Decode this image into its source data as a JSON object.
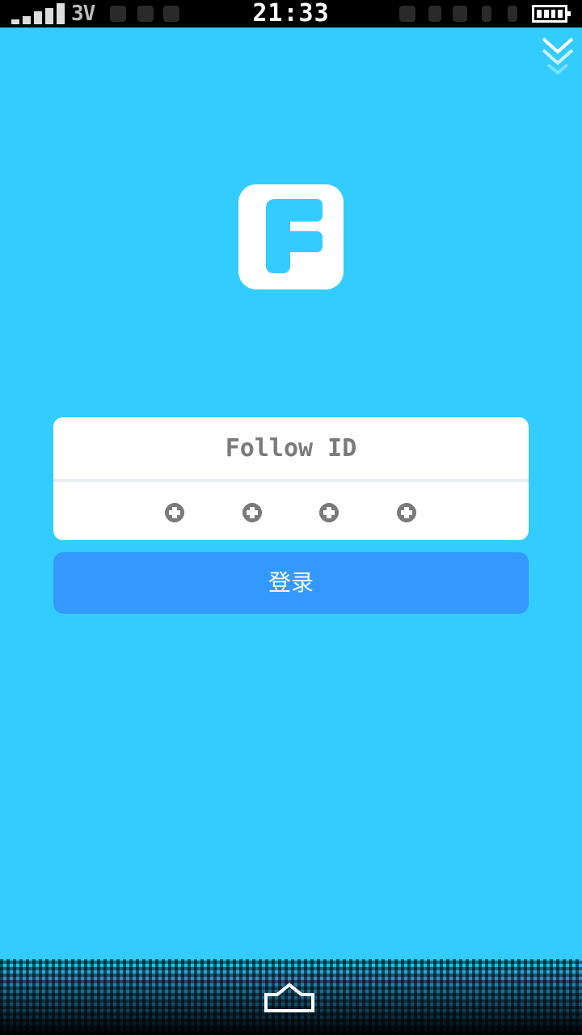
{
  "status_bar": {
    "network": "3V",
    "time": "21:33",
    "icons": [
      "signal-icon",
      "wifi-icon",
      "usb-icon",
      "sync-icon",
      "alarm-icon",
      "bluetooth-icon",
      "battery-icon"
    ]
  },
  "colors": {
    "background": "#33CCFF",
    "card": "#FFFFFF",
    "login_button": "#3399FF",
    "placeholder_text": "#7A7A7A"
  },
  "logo": {
    "icon": "app-logo-f-icon"
  },
  "login": {
    "id_placeholder": "Follow ID",
    "password_dots": 4,
    "login_label": "登录"
  },
  "footer": {
    "icon": "home-icon"
  }
}
